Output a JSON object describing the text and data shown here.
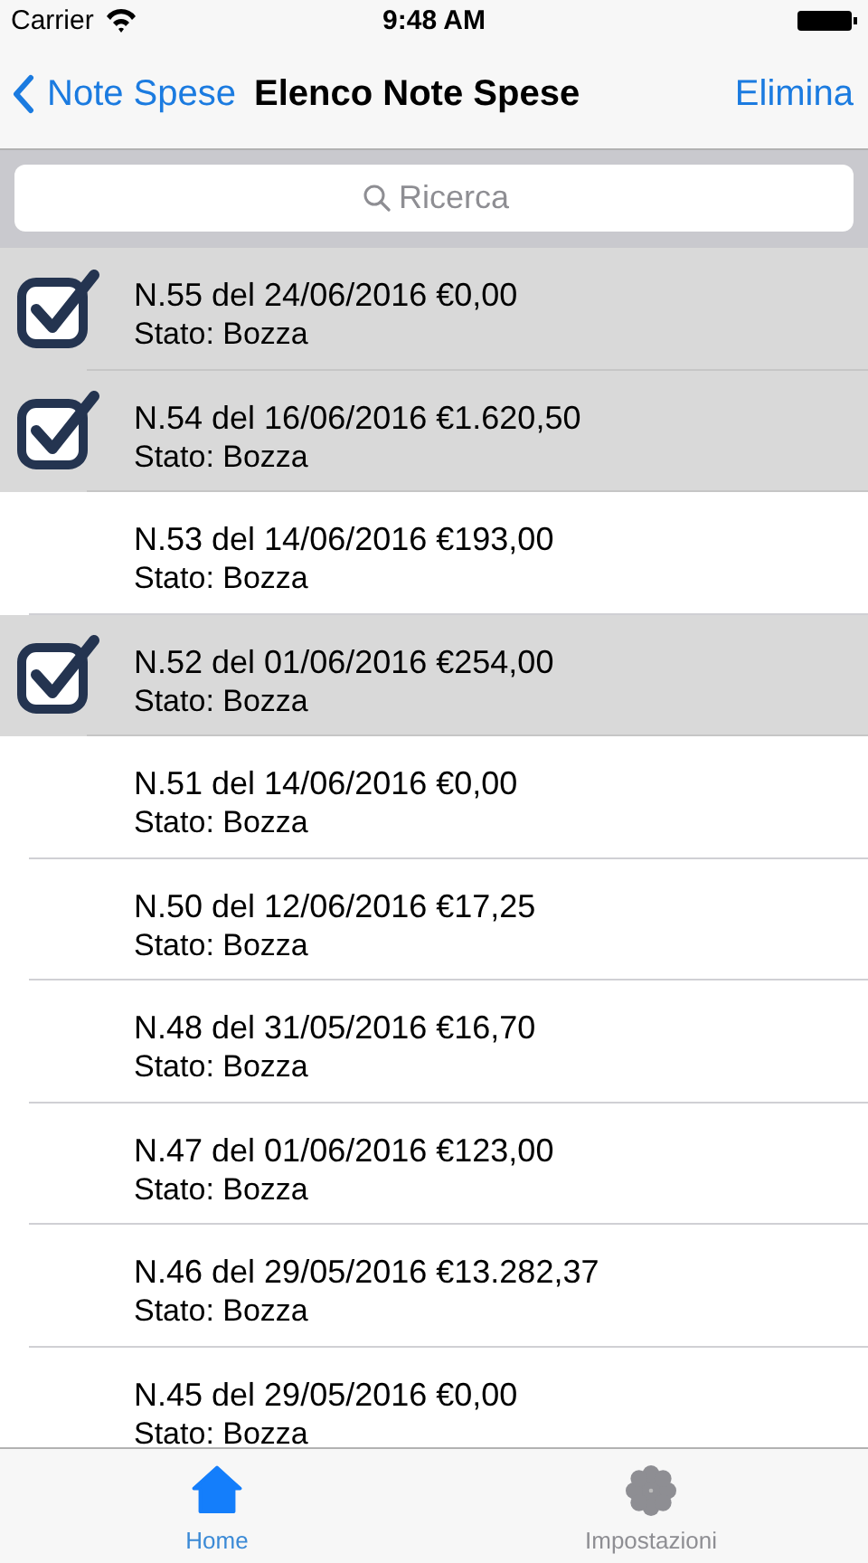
{
  "status_bar": {
    "carrier": "Carrier",
    "time": "9:48 AM"
  },
  "nav_bar": {
    "back": "Note Spese",
    "title": "Elenco Note Spese",
    "action": "Elimina"
  },
  "search": {
    "placeholder": "Ricerca"
  },
  "rows": [
    {
      "title": "N.55 del 24/06/2016 €0,00",
      "subtitle": "Stato: Bozza",
      "selected": true
    },
    {
      "title": "N.54 del 16/06/2016 €1.620,50",
      "subtitle": "Stato: Bozza",
      "selected": true
    },
    {
      "title": "N.53 del 14/06/2016 €193,00",
      "subtitle": "Stato: Bozza",
      "selected": false
    },
    {
      "title": "N.52 del 01/06/2016 €254,00",
      "subtitle": "Stato: Bozza",
      "selected": true
    },
    {
      "title": "N.51 del 14/06/2016 €0,00",
      "subtitle": "Stato: Bozza",
      "selected": false
    },
    {
      "title": "N.50 del 12/06/2016 €17,25",
      "subtitle": "Stato: Bozza",
      "selected": false
    },
    {
      "title": "N.48 del 31/05/2016 €16,70",
      "subtitle": "Stato: Bozza",
      "selected": false
    },
    {
      "title": "N.47 del 01/06/2016 €123,00",
      "subtitle": "Stato: Bozza",
      "selected": false
    },
    {
      "title": "N.46 del 29/05/2016 €13.282,37",
      "subtitle": "Stato: Bozza",
      "selected": false
    },
    {
      "title": "N.45 del 29/05/2016 €0,00",
      "subtitle": "Stato: Bozza",
      "selected": false
    }
  ],
  "tab_bar": [
    {
      "label": "Home",
      "kind": "home",
      "selected": true
    },
    {
      "label": "Impostazioni",
      "kind": "gear",
      "selected": false
    }
  ]
}
